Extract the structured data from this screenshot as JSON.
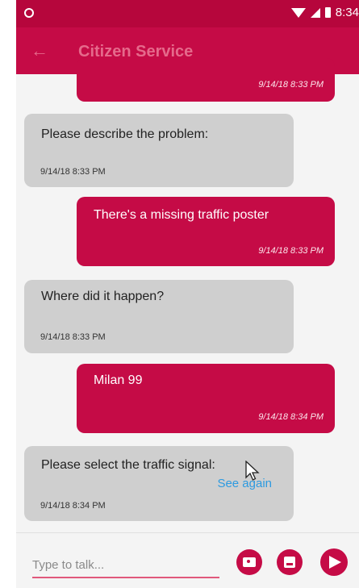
{
  "status_bar": {
    "time": "8:34"
  },
  "app_bar": {
    "title": "Citizen Service",
    "back_icon": "arrow-left-icon"
  },
  "messages": [
    {
      "side": "out",
      "text": "",
      "time": "9/14/18 8:33 PM"
    },
    {
      "side": "in",
      "text": "Please describe the problem:",
      "time": "9/14/18 8:33 PM"
    },
    {
      "side": "out",
      "text": "There's a missing traffic poster",
      "time": "9/14/18 8:33 PM"
    },
    {
      "side": "in",
      "text": "Where did it happen?",
      "time": "9/14/18 8:33 PM"
    },
    {
      "side": "out",
      "text": "Milan 99",
      "time": "9/14/18 8:34 PM"
    },
    {
      "side": "in",
      "text": "Please select the traffic signal:",
      "link": "See again",
      "time": "9/14/18 8:34 PM"
    }
  ],
  "composer": {
    "placeholder": "Type to talk...",
    "camera_icon": "camera-icon",
    "gallery_icon": "image-icon",
    "send_icon": "send-icon"
  },
  "colors": {
    "primary": "#c50b46",
    "status_bar": "#b6063c",
    "incoming": "#cfcfcf",
    "link": "#2d9ae0"
  }
}
